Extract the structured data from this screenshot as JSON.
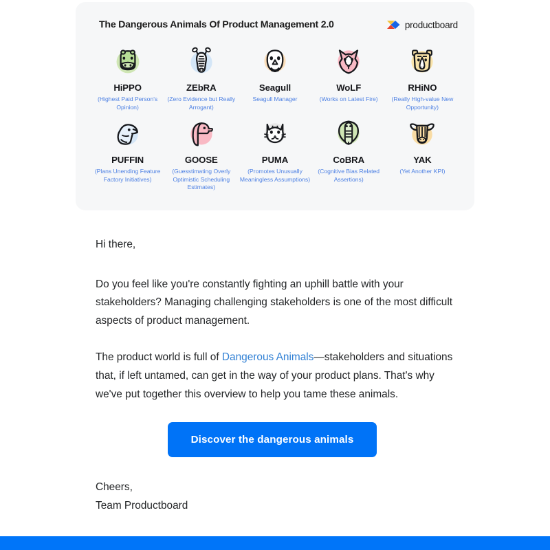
{
  "hero": {
    "title": "The Dangerous Animals Of Product Management 2.0",
    "brand_name": "productboard",
    "brand_mark_icon": "productboard-logo-icon",
    "colors": {
      "card_bg": "#f6f7f8",
      "title": "#1c1c1c",
      "desc_blue": "#4b7fe3"
    },
    "animals": [
      {
        "name": "HiPPO",
        "desc": "(Highest Paid Person's Opinion)",
        "icon": "hippo-icon",
        "bg": "#cfe6b4"
      },
      {
        "name": "ZEbRA",
        "desc": "(Zero Evidence but Really Arrogant)",
        "icon": "zebra-icon",
        "bg": "#d4e6f7"
      },
      {
        "name": "Seagull",
        "desc": "Seagull Manager",
        "icon": "seagull-icon",
        "bg": "#fbddb8"
      },
      {
        "name": "WoLF",
        "desc": "(Works on Latest Fire)",
        "icon": "wolf-icon",
        "bg": "#f9b9c4"
      },
      {
        "name": "RHiNO",
        "desc": "(Really High-value New Opportunity)",
        "icon": "rhino-icon",
        "bg": "#f9e3a8"
      },
      {
        "name": "PUFFIN",
        "desc": "(Plans Unending Feature Factory Initiatives)",
        "icon": "puffin-icon",
        "bg": "#d4e6f7"
      },
      {
        "name": "GOOSE",
        "desc": "(Guesstimating Overly Optimistic Scheduling Estimates)",
        "icon": "goose-icon",
        "bg": "#f9b9c4"
      },
      {
        "name": "PUMA",
        "desc": "(Promotes Unusually Meaningless Assumptions)",
        "icon": "puma-icon",
        "bg": "#e8e8e8"
      },
      {
        "name": "CoBRA",
        "desc": "(Cognitive Bias Related Assertions)",
        "icon": "cobra-icon",
        "bg": "#cfe6b4"
      },
      {
        "name": "YAK",
        "desc": "(Yet Another KPI)",
        "icon": "yak-icon",
        "bg": "#f9dca4"
      }
    ]
  },
  "body": {
    "greeting": "Hi there,",
    "paragraph_1": "Do you feel like you're constantly fighting an uphill battle with your stakeholders? Managing challenging stakeholders is one of the most difficult aspects of product management.",
    "paragraph_2_before": "The product world is full of ",
    "paragraph_2_link": "Dangerous Animals",
    "paragraph_2_after": "—stakeholders and situations that, if left untamed, can get in the way of your product plans. That's why we've put together this overview to help you tame these animals.",
    "cta_label": "Discover the dangerous animals",
    "signoff_line_1": "Cheers,",
    "signoff_line_2": "Team Productboard",
    "colors": {
      "text": "#222426",
      "link": "#2f7fd4",
      "cta_bg": "#0073f7",
      "cta_text": "#ffffff"
    }
  },
  "footer": {
    "bar_color": "#0075f9"
  }
}
